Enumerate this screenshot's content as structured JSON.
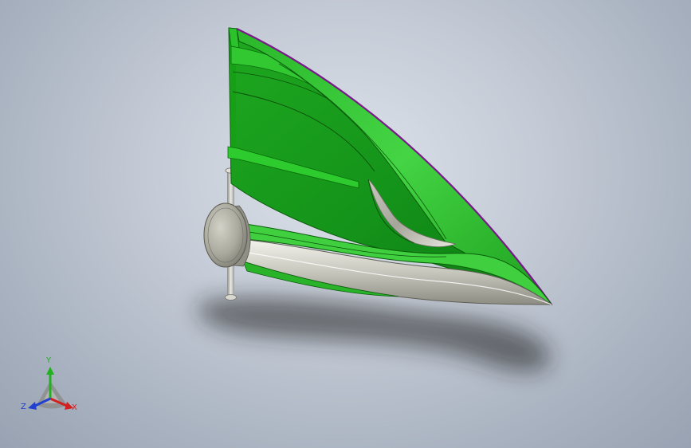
{
  "viewport": {
    "background_top": "#dde2ea",
    "background_bottom": "#98a2b2"
  },
  "model": {
    "body_color": "#22bb22",
    "body_dark": "#118811",
    "body_light": "#55e055",
    "metal_light": "#e6e6e0",
    "metal_dark": "#8a8a80",
    "edge_color": "#7a1a8a"
  },
  "triad": {
    "x_label": "X",
    "y_label": "Y",
    "z_label": "Z",
    "x_color": "#d02020",
    "y_color": "#20b020",
    "z_color": "#2040d0"
  }
}
